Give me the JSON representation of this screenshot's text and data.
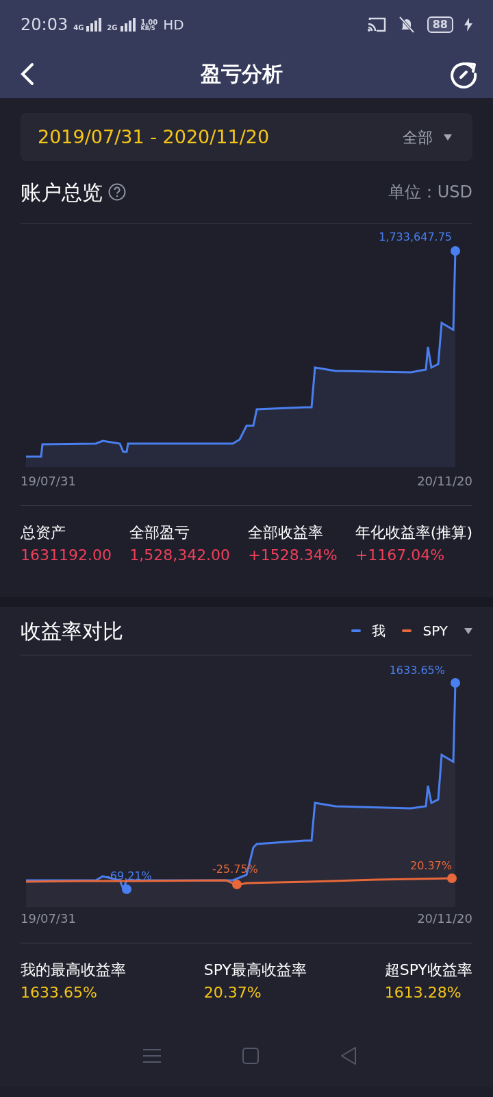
{
  "status_bar": {
    "time": "20:03",
    "network_1": "4G",
    "network_2": "2G",
    "speed": "1.00",
    "speed_unit": "KB/S",
    "hd": "HD",
    "battery": "88"
  },
  "header": {
    "title": "盈亏分析"
  },
  "date_range": {
    "range": "2019/07/31 - 2020/11/20",
    "filter": "全部"
  },
  "account_overview": {
    "title": "账户总览",
    "unit": "单位：USD",
    "chart": {
      "max_label": "1,733,647.75",
      "x_start": "19/07/31",
      "x_end": "20/11/20"
    },
    "stats": [
      {
        "label": "总资产",
        "value": "1631192.00"
      },
      {
        "label": "全部盈亏",
        "value": "1,528,342.00"
      },
      {
        "label": "全部收益率",
        "value": "+1528.34%"
      },
      {
        "label": "年化收益率(推算)",
        "value": "+1167.04%"
      }
    ]
  },
  "return_comparison": {
    "title": "收益率对比",
    "legend": [
      {
        "name": "我",
        "color": "#4a7ff0"
      },
      {
        "name": "SPY",
        "color": "#e8683a"
      }
    ],
    "chart": {
      "max_label": "1633.65%",
      "my_min_label": "-69.21%",
      "spy_min_label": "-25.75%",
      "spy_end_label": "20.37%",
      "x_start": "19/07/31",
      "x_end": "20/11/20"
    },
    "stats": [
      {
        "label": "我的最高收益率",
        "value": "1633.65%"
      },
      {
        "label": "SPY最高收益率",
        "value": "20.37%"
      },
      {
        "label": "超SPY收益率",
        "value": "1613.28%"
      }
    ]
  }
}
